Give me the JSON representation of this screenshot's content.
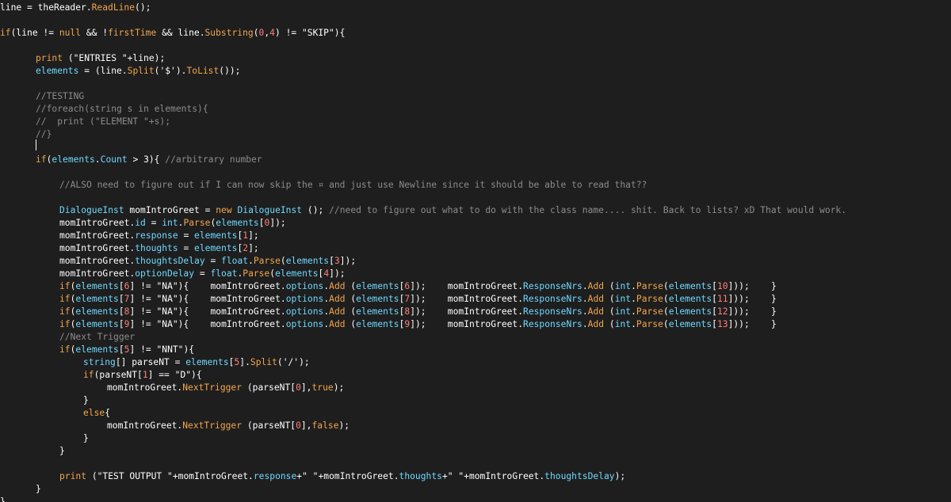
{
  "colors": {
    "background": "#1e1e1e",
    "default_text": "#ffffff",
    "keyword": "#f2a64d",
    "method": "#f2a64d",
    "property": "#6fd9ff",
    "number": "#ff7f79",
    "comment": "#8c8c8c"
  },
  "code_lines": [
    {
      "indent": 0,
      "tokens": [
        [
          "v",
          "line = theReader."
        ],
        [
          "m",
          "ReadLine"
        ],
        [
          "v",
          "();"
        ]
      ]
    },
    {
      "indent": 0,
      "tokens": []
    },
    {
      "indent": 0,
      "tokens": [
        [
          "k",
          "if"
        ],
        [
          "v",
          "(line != "
        ],
        [
          "k",
          "null"
        ],
        [
          "v",
          " && !"
        ],
        [
          "m",
          "firstTime"
        ],
        [
          "v",
          " && line."
        ],
        [
          "m",
          "Substring"
        ],
        [
          "v",
          "("
        ],
        [
          "n",
          "0"
        ],
        [
          "v",
          ","
        ],
        [
          "n",
          "4"
        ],
        [
          "v",
          ") != \"SKIP\"){"
        ]
      ]
    },
    {
      "indent": 0,
      "tokens": []
    },
    {
      "indent": 1,
      "tokens": [
        [
          "m",
          "print"
        ],
        [
          "v",
          " (\"ENTRIES \"+line);"
        ]
      ]
    },
    {
      "indent": 1,
      "tokens": [
        [
          "p",
          "elements"
        ],
        [
          "v",
          " = (line."
        ],
        [
          "m",
          "Split"
        ],
        [
          "v",
          "('$')."
        ],
        [
          "m",
          "ToList"
        ],
        [
          "v",
          "());"
        ]
      ]
    },
    {
      "indent": 0,
      "tokens": []
    },
    {
      "indent": 1,
      "tokens": [
        [
          "c",
          "//TESTING"
        ]
      ]
    },
    {
      "indent": 1,
      "tokens": [
        [
          "c",
          "//foreach(string s in elements){"
        ]
      ]
    },
    {
      "indent": 1,
      "tokens": [
        [
          "c",
          "//  print (\"ELEMENT \"+s);"
        ]
      ]
    },
    {
      "indent": 1,
      "tokens": [
        [
          "c",
          "//}"
        ]
      ]
    },
    {
      "indent": 0,
      "tokens": []
    },
    {
      "indent": 1,
      "tokens": [
        [
          "k",
          "if"
        ],
        [
          "v",
          "("
        ],
        [
          "p",
          "elements"
        ],
        [
          "v",
          "."
        ],
        [
          "p",
          "Count"
        ],
        [
          "v",
          " > 3){ "
        ],
        [
          "c",
          "//arbitrary number"
        ]
      ]
    },
    {
      "indent": 0,
      "tokens": []
    },
    {
      "indent": 2,
      "tokens": [
        [
          "c",
          "//ALSO need to figure out if I can now skip the ¤ and just use Newline since it should be able to read that??"
        ]
      ]
    },
    {
      "indent": 0,
      "tokens": []
    },
    {
      "indent": 2,
      "tokens": [
        [
          "p",
          "DialogueInst"
        ],
        [
          "v",
          " momIntroGreet = "
        ],
        [
          "k",
          "new"
        ],
        [
          "v",
          " "
        ],
        [
          "p",
          "DialogueInst"
        ],
        [
          "v",
          " (); "
        ],
        [
          "c",
          "//need to figure out what to do with the class name.... shit. Back to lists? xD That would work."
        ]
      ]
    },
    {
      "indent": 2,
      "tokens": [
        [
          "v",
          "momIntroGreet."
        ],
        [
          "p",
          "id"
        ],
        [
          "v",
          " = "
        ],
        [
          "p",
          "int"
        ],
        [
          "v",
          "."
        ],
        [
          "m",
          "Parse"
        ],
        [
          "v",
          "("
        ],
        [
          "p",
          "elements"
        ],
        [
          "v",
          "["
        ],
        [
          "n",
          "0"
        ],
        [
          "v",
          "]);"
        ]
      ]
    },
    {
      "indent": 2,
      "tokens": [
        [
          "v",
          "momIntroGreet."
        ],
        [
          "p",
          "response"
        ],
        [
          "v",
          " = "
        ],
        [
          "p",
          "elements"
        ],
        [
          "v",
          "["
        ],
        [
          "n",
          "1"
        ],
        [
          "v",
          "];"
        ]
      ]
    },
    {
      "indent": 2,
      "tokens": [
        [
          "v",
          "momIntroGreet."
        ],
        [
          "p",
          "thoughts"
        ],
        [
          "v",
          " = "
        ],
        [
          "p",
          "elements"
        ],
        [
          "v",
          "["
        ],
        [
          "n",
          "2"
        ],
        [
          "v",
          "];"
        ]
      ]
    },
    {
      "indent": 2,
      "tokens": [
        [
          "v",
          "momIntroGreet."
        ],
        [
          "p",
          "thoughtsDelay"
        ],
        [
          "v",
          " = "
        ],
        [
          "p",
          "float"
        ],
        [
          "v",
          "."
        ],
        [
          "m",
          "Parse"
        ],
        [
          "v",
          "("
        ],
        [
          "p",
          "elements"
        ],
        [
          "v",
          "["
        ],
        [
          "n",
          "3"
        ],
        [
          "v",
          "]);"
        ]
      ]
    },
    {
      "indent": 2,
      "tokens": [
        [
          "v",
          "momIntroGreet."
        ],
        [
          "p",
          "optionDelay"
        ],
        [
          "v",
          " = "
        ],
        [
          "p",
          "float"
        ],
        [
          "v",
          "."
        ],
        [
          "m",
          "Parse"
        ],
        [
          "v",
          "("
        ],
        [
          "p",
          "elements"
        ],
        [
          "v",
          "["
        ],
        [
          "n",
          "4"
        ],
        [
          "v",
          "]);"
        ]
      ]
    },
    {
      "indent": 2,
      "tokens": [
        [
          "k",
          "if"
        ],
        [
          "v",
          "("
        ],
        [
          "p",
          "elements"
        ],
        [
          "v",
          "["
        ],
        [
          "n",
          "6"
        ],
        [
          "v",
          "] != \"NA\"){    momIntroGreet."
        ],
        [
          "p",
          "options"
        ],
        [
          "v",
          "."
        ],
        [
          "m",
          "Add"
        ],
        [
          "v",
          " ("
        ],
        [
          "p",
          "elements"
        ],
        [
          "v",
          "["
        ],
        [
          "n",
          "6"
        ],
        [
          "v",
          "]);    momIntroGreet."
        ],
        [
          "p",
          "ResponseNrs"
        ],
        [
          "v",
          "."
        ],
        [
          "m",
          "Add"
        ],
        [
          "v",
          " ("
        ],
        [
          "p",
          "int"
        ],
        [
          "v",
          "."
        ],
        [
          "m",
          "Parse"
        ],
        [
          "v",
          "("
        ],
        [
          "p",
          "elements"
        ],
        [
          "v",
          "["
        ],
        [
          "n",
          "10"
        ],
        [
          "v",
          "]));    }"
        ]
      ]
    },
    {
      "indent": 2,
      "tokens": [
        [
          "k",
          "if"
        ],
        [
          "v",
          "("
        ],
        [
          "p",
          "elements"
        ],
        [
          "v",
          "["
        ],
        [
          "n",
          "7"
        ],
        [
          "v",
          "] != \"NA\"){    momIntroGreet."
        ],
        [
          "p",
          "options"
        ],
        [
          "v",
          "."
        ],
        [
          "m",
          "Add"
        ],
        [
          "v",
          " ("
        ],
        [
          "p",
          "elements"
        ],
        [
          "v",
          "["
        ],
        [
          "n",
          "7"
        ],
        [
          "v",
          "]);    momIntroGreet."
        ],
        [
          "p",
          "ResponseNrs"
        ],
        [
          "v",
          "."
        ],
        [
          "m",
          "Add"
        ],
        [
          "v",
          " ("
        ],
        [
          "p",
          "int"
        ],
        [
          "v",
          "."
        ],
        [
          "m",
          "Parse"
        ],
        [
          "v",
          "("
        ],
        [
          "p",
          "elements"
        ],
        [
          "v",
          "["
        ],
        [
          "n",
          "11"
        ],
        [
          "v",
          "]));    }"
        ]
      ]
    },
    {
      "indent": 2,
      "tokens": [
        [
          "k",
          "if"
        ],
        [
          "v",
          "("
        ],
        [
          "p",
          "elements"
        ],
        [
          "v",
          "["
        ],
        [
          "n",
          "8"
        ],
        [
          "v",
          "] != \"NA\"){    momIntroGreet."
        ],
        [
          "p",
          "options"
        ],
        [
          "v",
          "."
        ],
        [
          "m",
          "Add"
        ],
        [
          "v",
          " ("
        ],
        [
          "p",
          "elements"
        ],
        [
          "v",
          "["
        ],
        [
          "n",
          "8"
        ],
        [
          "v",
          "]);    momIntroGreet."
        ],
        [
          "p",
          "ResponseNrs"
        ],
        [
          "v",
          "."
        ],
        [
          "m",
          "Add"
        ],
        [
          "v",
          " ("
        ],
        [
          "p",
          "int"
        ],
        [
          "v",
          "."
        ],
        [
          "m",
          "Parse"
        ],
        [
          "v",
          "("
        ],
        [
          "p",
          "elements"
        ],
        [
          "v",
          "["
        ],
        [
          "n",
          "12"
        ],
        [
          "v",
          "]));    }"
        ]
      ]
    },
    {
      "indent": 2,
      "tokens": [
        [
          "k",
          "if"
        ],
        [
          "v",
          "("
        ],
        [
          "p",
          "elements"
        ],
        [
          "v",
          "["
        ],
        [
          "n",
          "9"
        ],
        [
          "v",
          "] != \"NA\"){    momIntroGreet."
        ],
        [
          "p",
          "options"
        ],
        [
          "v",
          "."
        ],
        [
          "m",
          "Add"
        ],
        [
          "v",
          " ("
        ],
        [
          "p",
          "elements"
        ],
        [
          "v",
          "["
        ],
        [
          "n",
          "9"
        ],
        [
          "v",
          "]);    momIntroGreet."
        ],
        [
          "p",
          "ResponseNrs"
        ],
        [
          "v",
          "."
        ],
        [
          "m",
          "Add"
        ],
        [
          "v",
          " ("
        ],
        [
          "p",
          "int"
        ],
        [
          "v",
          "."
        ],
        [
          "m",
          "Parse"
        ],
        [
          "v",
          "("
        ],
        [
          "p",
          "elements"
        ],
        [
          "v",
          "["
        ],
        [
          "n",
          "13"
        ],
        [
          "v",
          "]));    }"
        ]
      ]
    },
    {
      "indent": 2,
      "tokens": [
        [
          "c",
          "//Next Trigger"
        ]
      ]
    },
    {
      "indent": 2,
      "tokens": [
        [
          "k",
          "if"
        ],
        [
          "v",
          "("
        ],
        [
          "p",
          "elements"
        ],
        [
          "v",
          "["
        ],
        [
          "n",
          "5"
        ],
        [
          "v",
          "] != \"NNT\"){"
        ]
      ]
    },
    {
      "indent": 3,
      "tokens": [
        [
          "p",
          "string"
        ],
        [
          "v",
          "[] parseNT = "
        ],
        [
          "p",
          "elements"
        ],
        [
          "v",
          "["
        ],
        [
          "n",
          "5"
        ],
        [
          "v",
          "]."
        ],
        [
          "m",
          "Split"
        ],
        [
          "v",
          "('/');"
        ]
      ]
    },
    {
      "indent": 3,
      "tokens": [
        [
          "k",
          "if"
        ],
        [
          "v",
          "(parseNT["
        ],
        [
          "n",
          "1"
        ],
        [
          "v",
          "] == \"D\"){"
        ]
      ]
    },
    {
      "indent": 4,
      "tokens": [
        [
          "v",
          "momIntroGreet."
        ],
        [
          "m",
          "NextTrigger"
        ],
        [
          "v",
          " (parseNT["
        ],
        [
          "n",
          "0"
        ],
        [
          "v",
          "],"
        ],
        [
          "k",
          "true"
        ],
        [
          "v",
          ");"
        ]
      ]
    },
    {
      "indent": 3,
      "tokens": [
        [
          "v",
          "}"
        ]
      ]
    },
    {
      "indent": 3,
      "tokens": [
        [
          "k",
          "else"
        ],
        [
          "v",
          "{"
        ]
      ]
    },
    {
      "indent": 4,
      "tokens": [
        [
          "v",
          "momIntroGreet."
        ],
        [
          "m",
          "NextTrigger"
        ],
        [
          "v",
          " (parseNT["
        ],
        [
          "n",
          "0"
        ],
        [
          "v",
          "],"
        ],
        [
          "k",
          "false"
        ],
        [
          "v",
          ");"
        ]
      ]
    },
    {
      "indent": 3,
      "tokens": [
        [
          "v",
          "}"
        ]
      ]
    },
    {
      "indent": 2,
      "tokens": [
        [
          "v",
          "}"
        ]
      ]
    },
    {
      "indent": 0,
      "tokens": []
    },
    {
      "indent": 2,
      "tokens": [
        [
          "m",
          "print"
        ],
        [
          "v",
          " (\"TEST OUTPUT \"+momIntroGreet."
        ],
        [
          "p",
          "response"
        ],
        [
          "v",
          "+\" \"+momIntroGreet."
        ],
        [
          "p",
          "thoughts"
        ],
        [
          "v",
          "+\" \"+momIntroGreet."
        ],
        [
          "p",
          "thoughtsDelay"
        ],
        [
          "v",
          ");"
        ]
      ]
    },
    {
      "indent": 1,
      "tokens": [
        [
          "v",
          "}"
        ]
      ]
    },
    {
      "indent": 0,
      "tokens": [
        [
          "v",
          "}"
        ]
      ]
    }
  ]
}
